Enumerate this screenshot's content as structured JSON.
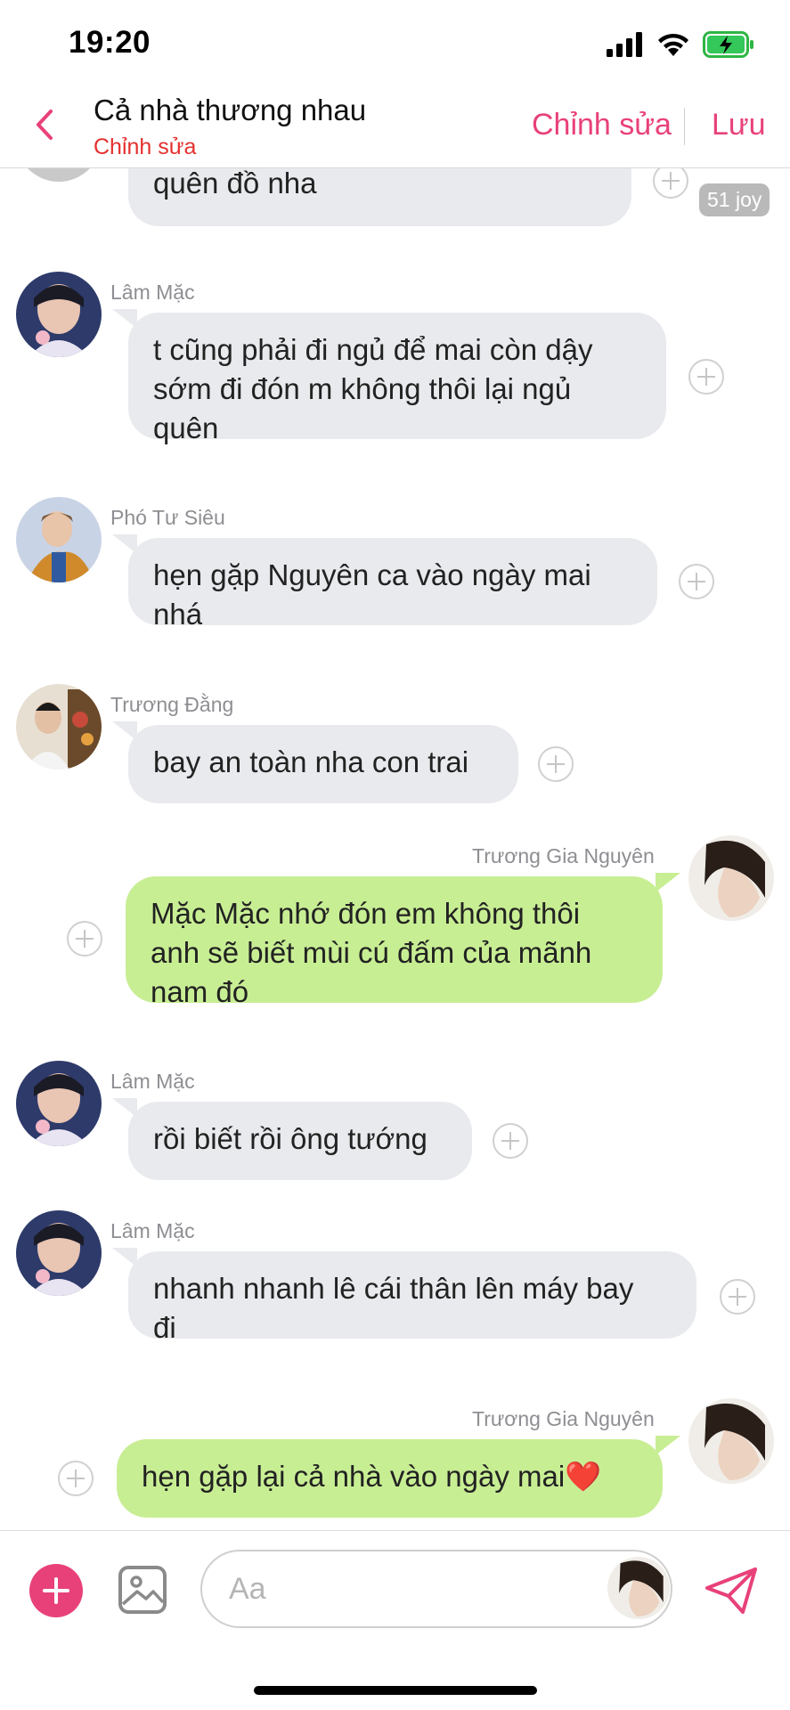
{
  "status": {
    "time": "19:20"
  },
  "header": {
    "title": "Cả nhà thương nhau",
    "subtitle": "Chỉnh sửa",
    "edit_label": "Chỉnh sửa",
    "save_label": "Lưu"
  },
  "colors": {
    "accent": "#e8417a",
    "incoming_bubble": "#e8eaed",
    "outgoing_bubble": "#c8ee94"
  },
  "messages": [
    {
      "text": "đã nhớ xem cẩn thận coi chừng\nquên đồ nha",
      "direction": "in",
      "reaction_badge": "51 joy"
    },
    {
      "sender": "Lâm Mặc",
      "text": "t cũng phải đi ngủ để mai còn dậy\nsớm đi đón m không thôi lại ngủ\nquên",
      "direction": "in"
    },
    {
      "sender": "Phó Tư Siêu",
      "text": "hẹn gặp Nguyên ca vào ngày mai\nnhá",
      "direction": "in"
    },
    {
      "sender": "Trương Đằng",
      "text": "bay an toàn nha con trai",
      "direction": "in"
    },
    {
      "sender": "Trương Gia Nguyên",
      "text": "Mặc Mặc nhớ đón em không thôi\nanh sẽ biết mùi cú đấm của mãnh\nnam đó",
      "direction": "out"
    },
    {
      "sender": "Lâm Mặc",
      "text": "rồi biết rồi ông tướng",
      "direction": "in"
    },
    {
      "sender": "Lâm Mặc",
      "text": "nhanh nhanh lê cái thân lên máy bay\nđi",
      "direction": "in"
    },
    {
      "sender": "Trương Gia Nguyên",
      "text": "hẹn gặp lại cả nhà vào ngày mai❤️",
      "direction": "out"
    }
  ],
  "input": {
    "placeholder": "Aa"
  }
}
